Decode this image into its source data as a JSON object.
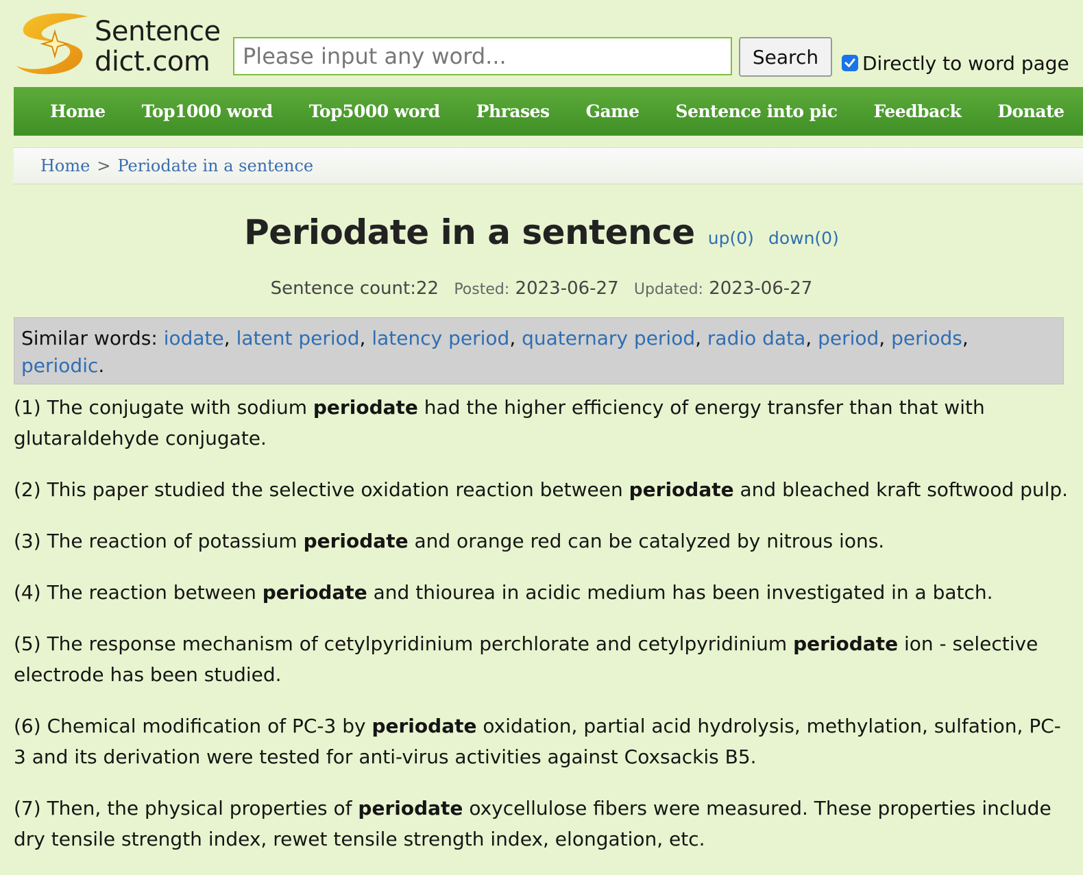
{
  "logo": {
    "line1": "Sentence",
    "line2": "dict.com"
  },
  "search": {
    "placeholder": "Please input any word...",
    "button_label": "Search"
  },
  "direct_option": {
    "label": "Directly to word page",
    "checked": true
  },
  "nav": [
    "Home",
    "Top1000 word",
    "Top5000 word",
    "Phrases",
    "Game",
    "Sentence into pic",
    "Feedback",
    "Donate"
  ],
  "breadcrumb": {
    "home": "Home",
    "separator": ">",
    "current": "Periodate in a sentence"
  },
  "page": {
    "title": "Periodate in a sentence",
    "up": "up(0)",
    "down": "down(0)",
    "sentence_count": "Sentence count:22",
    "posted_label": "Posted:",
    "posted_date": "2023-06-27",
    "updated_label": "Updated:",
    "updated_date": "2023-06-27"
  },
  "similar": {
    "label": "Similar words:",
    "words": [
      "iodate",
      "latent period",
      "latency period",
      "quaternary period",
      "radio data",
      "period",
      "periods",
      "periodic"
    ]
  },
  "sentences": [
    {
      "num": "(1)",
      "before": "The conjugate with sodium ",
      "keyword": "periodate",
      "after": " had the higher efficiency of energy transfer than that with glutaraldehyde conjugate."
    },
    {
      "num": "(2)",
      "before": "This paper studied the selective oxidation reaction between ",
      "keyword": "periodate",
      "after": " and bleached kraft softwood pulp."
    },
    {
      "num": "(3)",
      "before": "The reaction of potassium ",
      "keyword": "periodate",
      "after": " and orange red can be catalyzed by nitrous ions."
    },
    {
      "num": "(4)",
      "before": "The reaction between ",
      "keyword": "periodate",
      "after": " and thiourea in acidic medium has been investigated in a batch."
    },
    {
      "num": "(5)",
      "before": "The response mechanism of cetylpyridinium perchlorate and cetylpyridinium ",
      "keyword": "periodate",
      "after": " ion - selective electrode has been studied."
    },
    {
      "num": "(6)",
      "before": "Chemical modification of PC-3 by ",
      "keyword": "periodate",
      "after": " oxidation, partial acid hydrolysis, methylation, sulfation, PC-3 and its derivation were tested for anti-virus activities against Coxsackis B5."
    },
    {
      "num": "(7)",
      "before": "Then, the physical properties of ",
      "keyword": "periodate",
      "after": " oxycellulose fibers were measured. These properties include dry tensile strength index, rewet tensile strength index, elongation, etc."
    }
  ],
  "colors": {
    "background": "#e8f4cf",
    "nav": "#4a9a2c",
    "link": "#2f6eb3",
    "similar_bg": "#d0d0d0"
  }
}
